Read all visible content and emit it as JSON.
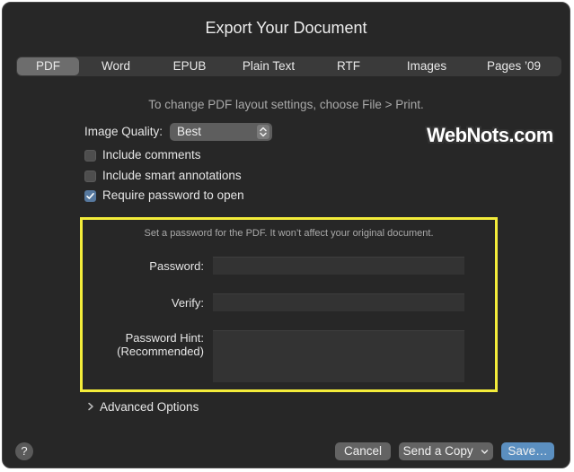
{
  "title": "Export Your Document",
  "tabs": [
    {
      "label": "PDF"
    },
    {
      "label": "Word"
    },
    {
      "label": "EPUB"
    },
    {
      "label": "Plain Text"
    },
    {
      "label": "RTF"
    },
    {
      "label": "Images"
    },
    {
      "label": "Pages ’09"
    }
  ],
  "active_tab": "PDF",
  "layout_hint": "To change PDF layout settings, choose File > Print.",
  "image_quality": {
    "label": "Image Quality:",
    "value": "Best"
  },
  "options": [
    {
      "label": "Include comments",
      "checked": false
    },
    {
      "label": "Include smart annotations",
      "checked": false
    },
    {
      "label": "Require password to open",
      "checked": true
    }
  ],
  "watermark": "WebNots.com",
  "password_section": {
    "hint": "Set a password for the PDF. It won’t affect your original document.",
    "password_label": "Password:",
    "verify_label": "Verify:",
    "hint_label_line1": "Password Hint:",
    "hint_label_line2": "(Recommended)",
    "password_value": "",
    "verify_value": "",
    "hint_value": ""
  },
  "advanced_label": "Advanced Options",
  "help_label": "?",
  "buttons": {
    "cancel": "Cancel",
    "send_copy": "Send a Copy",
    "save": "Save…"
  },
  "colors": {
    "dialog_bg": "#272727",
    "accent": "#5b8fc0",
    "highlight": "#f3ec3a"
  }
}
